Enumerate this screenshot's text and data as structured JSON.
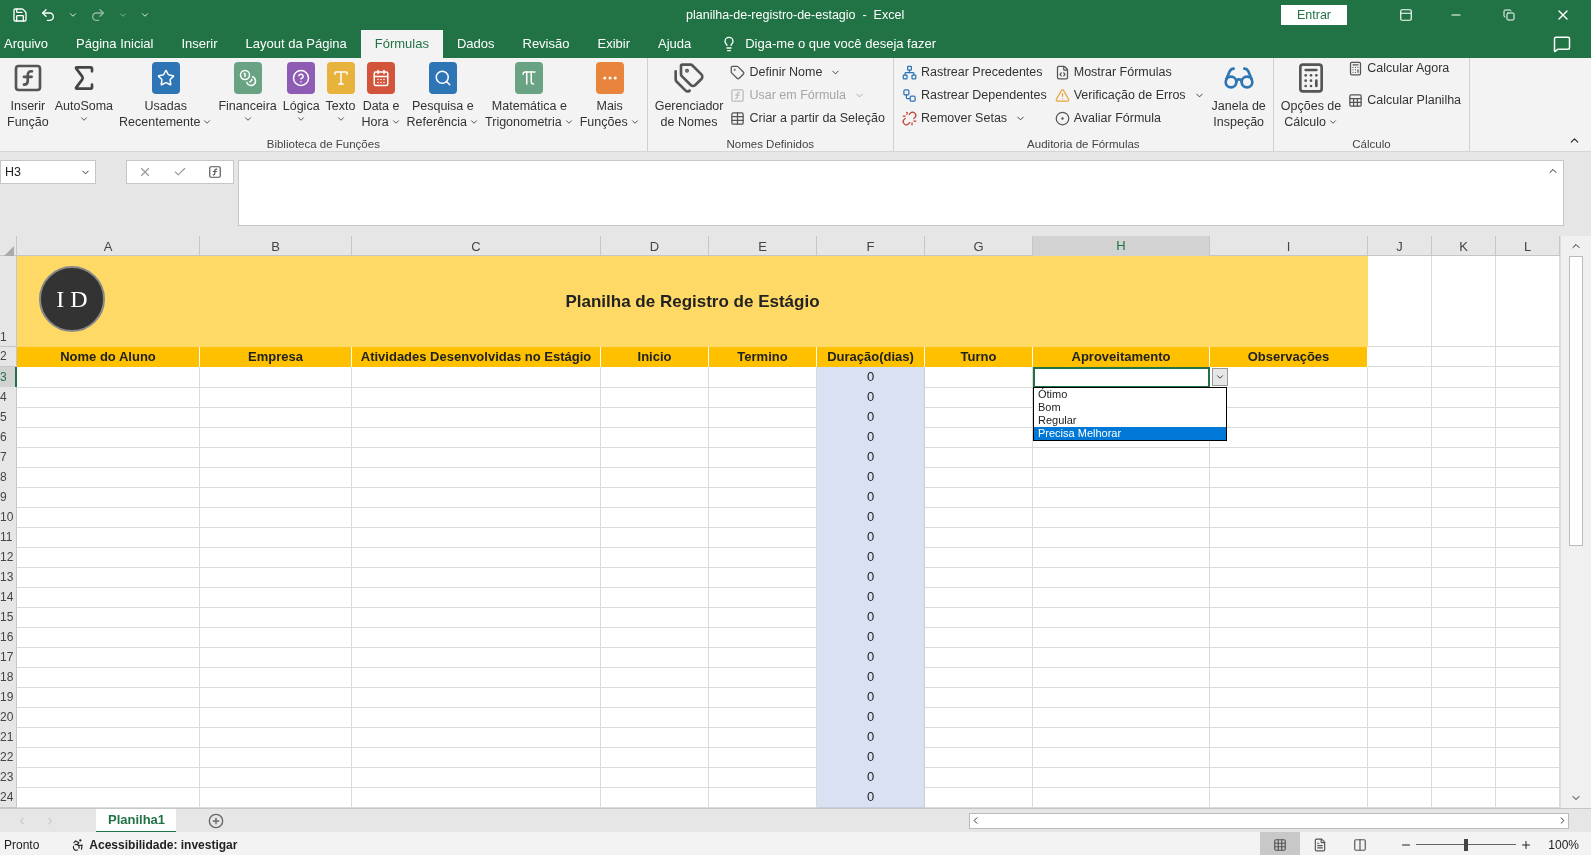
{
  "title_bar": {
    "title": "planilha-de-registro-de-estagio  -  Excel",
    "sign_in": "Entrar"
  },
  "menu_tabs": [
    {
      "label": "Arquivo",
      "selected": false
    },
    {
      "label": "Página Inicial",
      "selected": false
    },
    {
      "label": "Inserir",
      "selected": false
    },
    {
      "label": "Layout da Página",
      "selected": false
    },
    {
      "label": "Fórmulas",
      "selected": true
    },
    {
      "label": "Dados",
      "selected": false
    },
    {
      "label": "Revisão",
      "selected": false
    },
    {
      "label": "Exibir",
      "selected": false
    },
    {
      "label": "Ajuda",
      "selected": false
    }
  ],
  "tell_me": "Diga-me o que você deseja fazer",
  "ribbon": {
    "groups": [
      {
        "label": "Biblioteca de Funções",
        "items": [
          {
            "kind": "large",
            "lines": [
              "Inserir",
              "Função"
            ],
            "caret": false
          },
          {
            "kind": "large",
            "lines": [
              "AutoSoma"
            ],
            "caret": true
          },
          {
            "kind": "large",
            "lines": [
              "Usadas",
              "Recentemente"
            ],
            "caret": true
          },
          {
            "kind": "large",
            "lines": [
              "Financeira"
            ],
            "caret": true
          },
          {
            "kind": "large",
            "lines": [
              "Lógica"
            ],
            "caret": true
          },
          {
            "kind": "large",
            "lines": [
              "Texto"
            ],
            "caret": true
          },
          {
            "kind": "large",
            "lines": [
              "Data e",
              "Hora"
            ],
            "caret": true
          },
          {
            "kind": "large",
            "lines": [
              "Pesquisa e",
              "Referência"
            ],
            "caret": true
          },
          {
            "kind": "large",
            "lines": [
              "Matemática e",
              "Trigonometria"
            ],
            "caret": true
          },
          {
            "kind": "large",
            "lines": [
              "Mais",
              "Funções"
            ],
            "caret": true
          }
        ]
      },
      {
        "label": "Nomes Definidos",
        "items": [
          {
            "kind": "large",
            "lines": [
              "Gerenciador",
              "de Nomes"
            ],
            "caret": false
          },
          {
            "kind": "stack",
            "buttons": [
              {
                "label": "Definir Nome",
                "caret": true,
                "disabled": false
              },
              {
                "label": "Usar em Fórmula",
                "caret": true,
                "disabled": true
              },
              {
                "label": "Criar a partir da Seleção",
                "caret": false,
                "disabled": false
              }
            ]
          }
        ]
      },
      {
        "label": "Auditoria de Fórmulas",
        "items": [
          {
            "kind": "stack",
            "buttons": [
              {
                "label": "Rastrear Precedentes",
                "caret": false,
                "disabled": false
              },
              {
                "label": "Rastrear Dependentes",
                "caret": false,
                "disabled": false
              },
              {
                "label": "Remover Setas",
                "caret": true,
                "disabled": false
              }
            ]
          },
          {
            "kind": "stack",
            "buttons": [
              {
                "label": "Mostrar Fórmulas",
                "caret": false,
                "disabled": false
              },
              {
                "label": "Verificação de Erros",
                "caret": true,
                "disabled": false
              },
              {
                "label": "Avaliar Fórmula",
                "caret": false,
                "disabled": false
              }
            ]
          },
          {
            "kind": "large",
            "lines": [
              "Janela de",
              "Inspeção"
            ],
            "caret": false
          }
        ]
      },
      {
        "label": "Cálculo",
        "items": [
          {
            "kind": "large",
            "lines": [
              "Opções de",
              "Cálculo"
            ],
            "caret": true
          },
          {
            "kind": "stack",
            "buttons": [
              {
                "label": "Calcular Agora",
                "caret": false,
                "disabled": false
              },
              {
                "label": "Calcular Planilha",
                "caret": false,
                "disabled": false
              }
            ]
          }
        ]
      }
    ]
  },
  "name_box": "H3",
  "columns": [
    {
      "letter": "A",
      "selected": false
    },
    {
      "letter": "B",
      "selected": false
    },
    {
      "letter": "C",
      "selected": false
    },
    {
      "letter": "D",
      "selected": false
    },
    {
      "letter": "E",
      "selected": false
    },
    {
      "letter": "F",
      "selected": false
    },
    {
      "letter": "G",
      "selected": false
    },
    {
      "letter": "H",
      "selected": true
    },
    {
      "letter": "I",
      "selected": false
    },
    {
      "letter": "J",
      "selected": false
    },
    {
      "letter": "K",
      "selected": false
    },
    {
      "letter": "L",
      "selected": false
    }
  ],
  "sheet": {
    "logo": "I D",
    "title": "Planilha de Registro de Estágio",
    "title_row": "1",
    "header_row": "2",
    "headers": [
      "Nome do Aluno",
      "Empresa",
      "Atividades Desenvolvidas no Estágio",
      "Inicio",
      "Termino",
      "Duração(dias)",
      "Turno",
      "Aproveitamento",
      "Observações"
    ],
    "rows": [
      {
        "number": "3",
        "duration": "0",
        "selected": true
      },
      {
        "number": "4",
        "duration": "0",
        "selected": false
      },
      {
        "number": "5",
        "duration": "0",
        "selected": false
      },
      {
        "number": "6",
        "duration": "0",
        "selected": false
      },
      {
        "number": "7",
        "duration": "0",
        "selected": false
      },
      {
        "number": "8",
        "duration": "0",
        "selected": false
      },
      {
        "number": "9",
        "duration": "0",
        "selected": false
      },
      {
        "number": "10",
        "duration": "0",
        "selected": false
      },
      {
        "number": "11",
        "duration": "0",
        "selected": false
      },
      {
        "number": "12",
        "duration": "0",
        "selected": false
      },
      {
        "number": "13",
        "duration": "0",
        "selected": false
      },
      {
        "number": "14",
        "duration": "0",
        "selected": false
      },
      {
        "number": "15",
        "duration": "0",
        "selected": false
      },
      {
        "number": "16",
        "duration": "0",
        "selected": false
      },
      {
        "number": "17",
        "duration": "0",
        "selected": false
      },
      {
        "number": "18",
        "duration": "0",
        "selected": false
      },
      {
        "number": "19",
        "duration": "0",
        "selected": false
      },
      {
        "number": "20",
        "duration": "0",
        "selected": false
      },
      {
        "number": "21",
        "duration": "0",
        "selected": false
      },
      {
        "number": "22",
        "duration": "0",
        "selected": false
      },
      {
        "number": "23",
        "duration": "0",
        "selected": false
      },
      {
        "number": "24",
        "duration": "0",
        "selected": false
      }
    ]
  },
  "dropdown": {
    "options": [
      {
        "label": "Ótimo",
        "selected": false
      },
      {
        "label": "Bom",
        "selected": false
      },
      {
        "label": "Regular",
        "selected": false
      },
      {
        "label": "Precisa Melhorar",
        "selected": true
      }
    ]
  },
  "sheet_tabs": [
    {
      "label": "Planilha1",
      "selected": true
    }
  ],
  "status_bar": {
    "ready": "Pronto",
    "accessibility": "Acessibilidade: investigar",
    "views": [
      {
        "kind": "normal",
        "selected": true
      },
      {
        "kind": "page_layout",
        "selected": false
      },
      {
        "kind": "page_break",
        "selected": false
      }
    ],
    "zoom": {
      "level": 0.5,
      "reading": "100%"
    }
  }
}
